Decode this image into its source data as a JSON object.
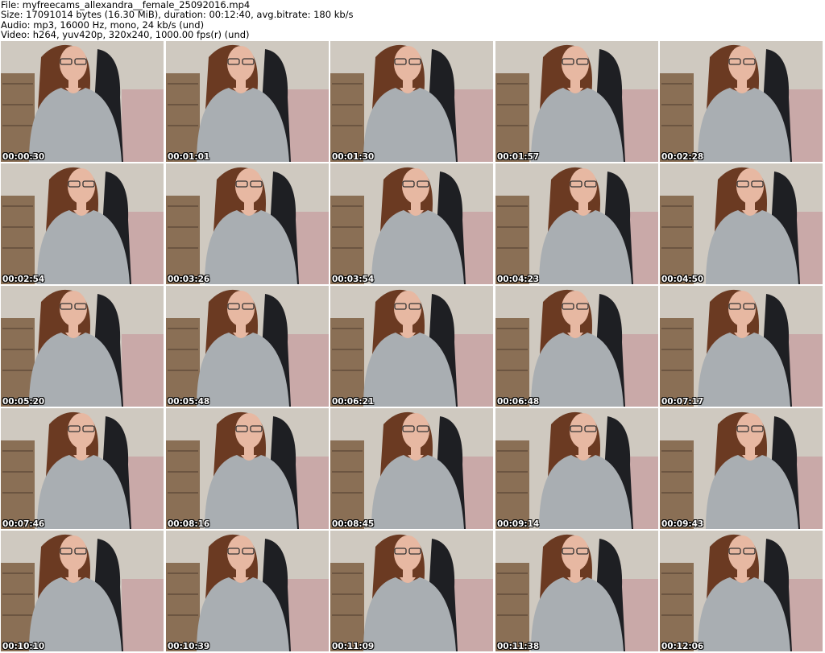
{
  "header": {
    "file_line": "File: myfreecams_allexandra__female_25092016.mp4",
    "size_line": "Size: 17091014 bytes (16.30 MiB), duration: 00:12:40, avg.bitrate: 180 kb/s",
    "audio_line": "Audio: mp3, 16000 Hz, mono, 24 kb/s (und)",
    "video_line": "Video: h264, yuv420p, 320x240, 1000.00 fps(r) (und)"
  },
  "thumbnails": [
    {
      "time": "00:00:30"
    },
    {
      "time": "00:01:01"
    },
    {
      "time": "00:01:30"
    },
    {
      "time": "00:01:57"
    },
    {
      "time": "00:02:28"
    },
    {
      "time": "00:02:54"
    },
    {
      "time": "00:03:26"
    },
    {
      "time": "00:03:54"
    },
    {
      "time": "00:04:23"
    },
    {
      "time": "00:04:50"
    },
    {
      "time": "00:05:20"
    },
    {
      "time": "00:05:48"
    },
    {
      "time": "00:06:21"
    },
    {
      "time": "00:06:48"
    },
    {
      "time": "00:07:17"
    },
    {
      "time": "00:07:46"
    },
    {
      "time": "00:08:16"
    },
    {
      "time": "00:08:45"
    },
    {
      "time": "00:09:14"
    },
    {
      "time": "00:09:43"
    },
    {
      "time": "00:10:10"
    },
    {
      "time": "00:10:39"
    },
    {
      "time": "00:11:09"
    },
    {
      "time": "00:11:38"
    },
    {
      "time": "00:12:06"
    }
  ],
  "colors": {
    "wall": "#cfc9c0",
    "dresser": "#8a6f55",
    "chair": "#1e1f23",
    "shirt": "#a9aeb2",
    "skin": "#e7b8a2",
    "hair": "#6b3a22",
    "bedspread": "#c9a9a8"
  }
}
